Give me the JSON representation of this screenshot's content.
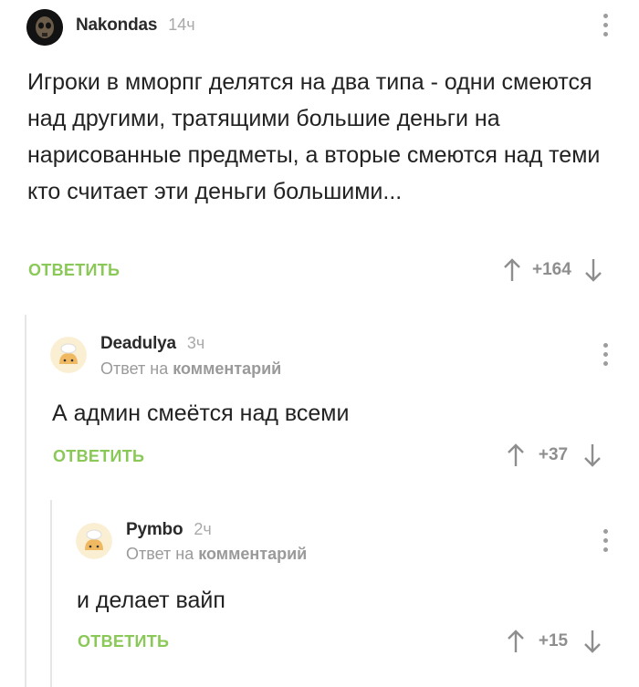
{
  "comments": [
    {
      "author": "Nakondas",
      "time": "14ч",
      "text": "Игроки в мморпг делятся на два типа - одни смеются над другими, тратящими большие деньги на нарисованные предметы, а вторые смеются над теми кто считает эти деньги большими...",
      "reply_label": "ОТВЕТИТЬ",
      "score": "+164"
    },
    {
      "author": "Deadulya",
      "time": "3ч",
      "reply_to_prefix": "Ответ на",
      "reply_to_target": "комментарий",
      "text": "А админ смеётся над всеми",
      "reply_label": "ОТВЕТИТЬ",
      "score": "+37"
    },
    {
      "author": "Pymbo",
      "time": "2ч",
      "reply_to_prefix": "Ответ на",
      "reply_to_target": "комментарий",
      "text": "и делает вайп",
      "reply_label": "ОТВЕТИТЬ",
      "score": "+15"
    }
  ],
  "colors": {
    "reply_green": "#8ac858",
    "muted": "#9a9a9a",
    "thread_line": "#e6e6e6"
  },
  "icons": {
    "upvote": "arrow-up-icon",
    "downvote": "arrow-down-icon",
    "more": "vertical-dots-icon",
    "avatar_default": "cook-hat-avatar"
  }
}
